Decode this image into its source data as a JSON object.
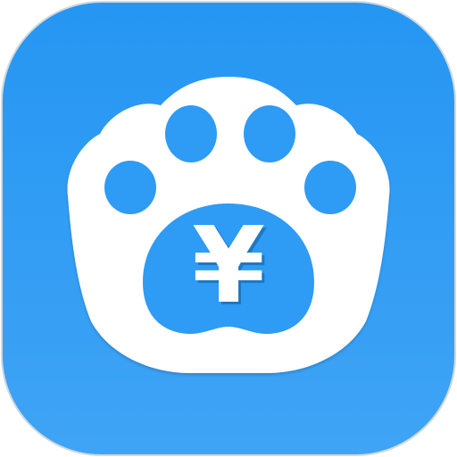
{
  "app_icon": {
    "name": "paw-yuan-wallet-app-icon",
    "symbol": "¥",
    "colors": {
      "background_top": "#2596f3",
      "background_bottom": "#3fa4f5",
      "background_border": "#cfd8df",
      "paw": "#ffffff",
      "paw_pad": "#2e9bf4",
      "symbol_shadow": "#145d99",
      "symbol": "#ffffff"
    }
  }
}
